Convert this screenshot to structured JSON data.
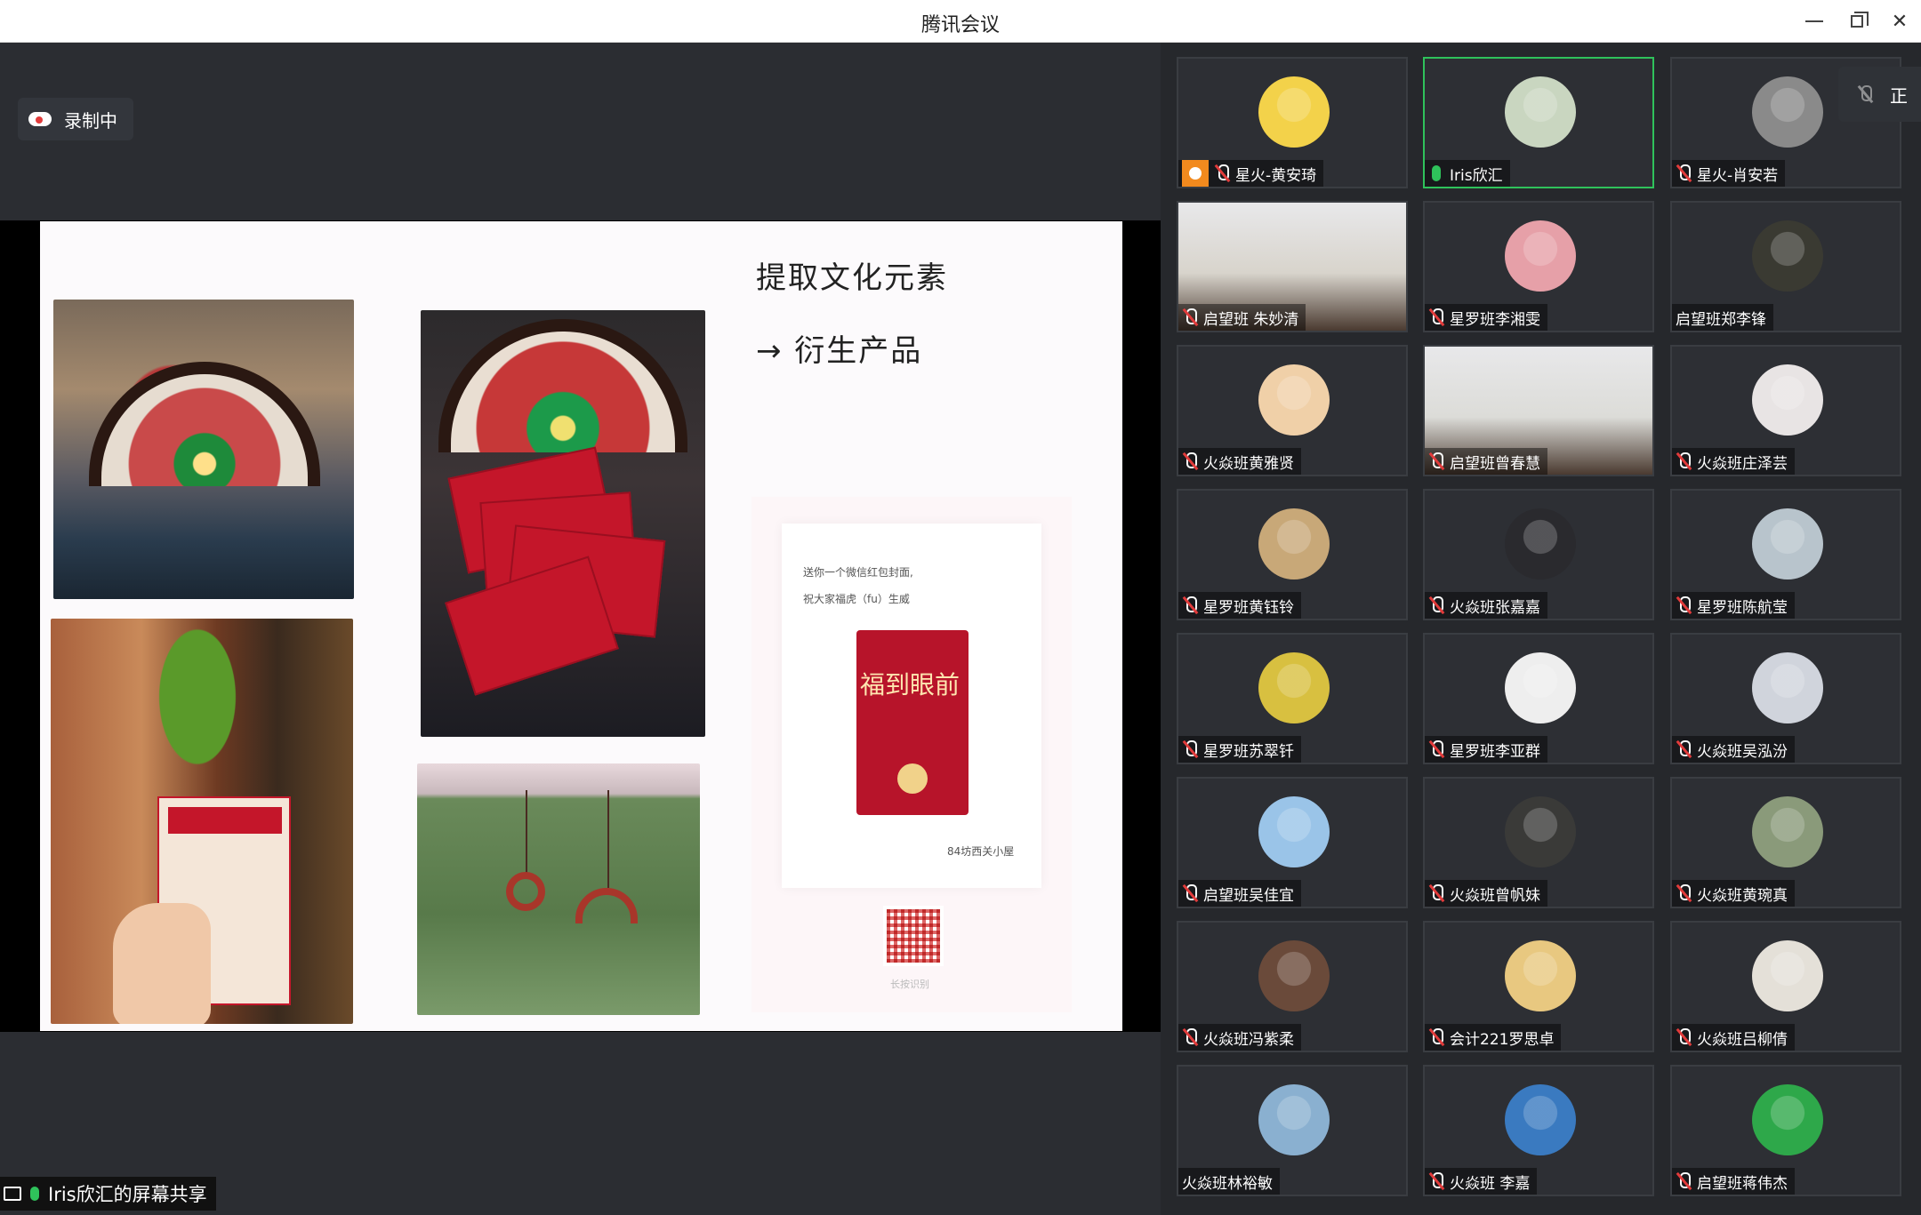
{
  "app": {
    "title": "腾讯会议"
  },
  "recording": {
    "label": "录制中"
  },
  "slide": {
    "heading": "提取文化元素",
    "sub_heading": "→ 衍生产品",
    "phone": {
      "line1": "送你一个微信红包封面,",
      "line2": "祝大家福虎（fu）生威",
      "envelope_text": "福到眼前",
      "shop": "84坊西关小屋",
      "qr_label": "长按识别"
    }
  },
  "share": {
    "label": "Iris欣汇的屏幕共享"
  },
  "side_chip": {
    "label": "正"
  },
  "participants": [
    {
      "name": "星火-黄安琦",
      "mic": "off",
      "host": true,
      "avatar_color": "#f3d24a"
    },
    {
      "name": "Iris欣汇",
      "mic": "on",
      "active": true,
      "avatar_color": "#c9d6c0"
    },
    {
      "name": "星火-肖安若",
      "mic": "off",
      "avatar_color": "#8a8a8a"
    },
    {
      "name": "启望班 朱妙清",
      "mic": "off",
      "video": true,
      "avatar_color": "#d8d4cc"
    },
    {
      "name": "星罗班李湘雯",
      "mic": "off",
      "avatar_color": "#e6a0a8"
    },
    {
      "name": "启望班郑李锋",
      "mic": "none",
      "avatar_color": "#3a3a32"
    },
    {
      "name": "火焱班黄雅贤",
      "mic": "off",
      "avatar_color": "#f0d0a8"
    },
    {
      "name": "启望班曾春慧",
      "mic": "off",
      "video": true,
      "avatar_color": "#dcdcd8"
    },
    {
      "name": "火焱班庄泽芸",
      "mic": "off",
      "avatar_color": "#e8e4e4"
    },
    {
      "name": "星罗班黄钰铃",
      "mic": "off",
      "avatar_color": "#c8a878"
    },
    {
      "name": "火焱班张嘉嘉",
      "mic": "off",
      "avatar_color": "#2a2a2e"
    },
    {
      "name": "星罗班陈航莹",
      "mic": "off",
      "avatar_color": "#b8c4cc"
    },
    {
      "name": "星罗班苏翠钎",
      "mic": "off",
      "avatar_color": "#d8c040"
    },
    {
      "name": "星罗班李亚群",
      "mic": "off",
      "avatar_color": "#eeeeee"
    },
    {
      "name": "火焱班吴泓汾",
      "mic": "off",
      "avatar_color": "#d0d4dc"
    },
    {
      "name": "启望班吴佳宜",
      "mic": "off",
      "avatar_color": "#9ac4e8"
    },
    {
      "name": "火焱班曾帆妹",
      "mic": "off",
      "avatar_color": "#3a3a38"
    },
    {
      "name": "火焱班黄琬真",
      "mic": "off",
      "avatar_color": "#8a9a7a"
    },
    {
      "name": "火焱班冯紫柔",
      "mic": "off",
      "avatar_color": "#6a4a3a"
    },
    {
      "name": "会计221罗思卓",
      "mic": "off",
      "avatar_color": "#e8c880"
    },
    {
      "name": "火焱班吕柳倩",
      "mic": "off",
      "avatar_color": "#e4e0d8"
    },
    {
      "name": "火焱班林裕敏",
      "mic": "none",
      "avatar_color": "#8ab0d0"
    },
    {
      "name": "火焱班 李嘉",
      "mic": "off",
      "avatar_color": "#3a7ac0"
    },
    {
      "name": "启望班蒋伟杰",
      "mic": "off",
      "avatar_color": "#2ea84a"
    }
  ]
}
